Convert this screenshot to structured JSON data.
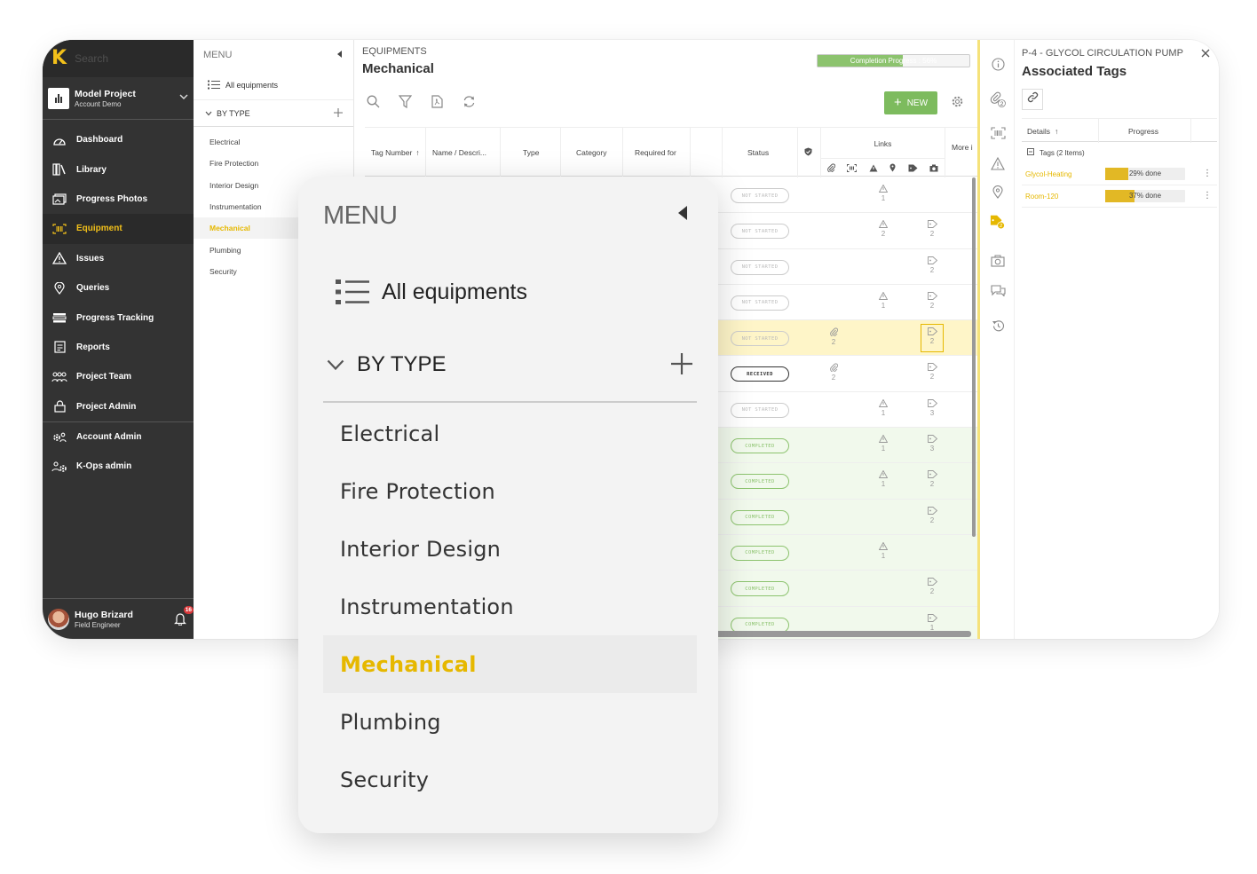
{
  "sidebar": {
    "search_placeholder": "Search",
    "project": {
      "name": "Model Project",
      "account": "Account Demo"
    },
    "items": [
      {
        "label": "Dashboard",
        "icon": "dashboard-icon"
      },
      {
        "label": "Library",
        "icon": "library-icon"
      },
      {
        "label": "Progress Photos",
        "icon": "photos-icon"
      },
      {
        "label": "Equipment",
        "icon": "barcode-icon",
        "active": true
      },
      {
        "label": "Issues",
        "icon": "warning-icon"
      },
      {
        "label": "Queries",
        "icon": "location-pin-icon"
      },
      {
        "label": "Progress Tracking",
        "icon": "tracking-icon"
      },
      {
        "label": "Reports",
        "icon": "report-icon"
      },
      {
        "label": "Project Team",
        "icon": "team-icon"
      },
      {
        "label": "Project Admin",
        "icon": "lock-icon"
      }
    ],
    "admin_items": [
      {
        "label": "Account Admin",
        "icon": "gear-users-icon"
      },
      {
        "label": "K-Ops admin",
        "icon": "gear-user-icon"
      }
    ],
    "user": {
      "name": "Hugo Brizard",
      "role": "Field Engineer",
      "notifications": "16"
    }
  },
  "menu": {
    "title": "MENU",
    "all_label": "All equipments",
    "by_type_label": "BY TYPE",
    "types": [
      "Electrical",
      "Fire Protection",
      "Interior Design",
      "Instrumentation",
      "Mechanical",
      "Plumbing",
      "Security"
    ],
    "active_type": "Mechanical"
  },
  "main": {
    "subtitle": "EQUIPMENTS",
    "title": "Mechanical",
    "progress_label": "Completion Progress : 56%",
    "progress_value": 56,
    "new_label": "NEW",
    "columns": [
      "Tag Number",
      "Name / Descri...",
      "Type",
      "Category",
      "Required for",
      "Status"
    ],
    "links_label": "Links",
    "more_label": "More i",
    "rows": [
      {
        "status": "NOT STARTED",
        "warn": "1",
        "clip": "",
        "tag": ""
      },
      {
        "status": "NOT STARTED",
        "warn": "2",
        "clip": "",
        "tag": "2"
      },
      {
        "status": "NOT STARTED",
        "warn": "",
        "clip": "",
        "tag": "2"
      },
      {
        "status": "NOT STARTED",
        "warn": "1",
        "clip": "",
        "tag": "2"
      },
      {
        "status": "NOT STARTED",
        "warn": "",
        "clip": "2",
        "tag": "2",
        "highlight": true
      },
      {
        "status": "RECEIVED",
        "warn": "",
        "clip": "2",
        "tag": "2"
      },
      {
        "status": "NOT STARTED",
        "warn": "1",
        "clip": "",
        "tag": "3"
      },
      {
        "status": "COMPLETED",
        "warn": "1",
        "clip": "",
        "tag": "3"
      },
      {
        "status": "COMPLETED",
        "warn": "1",
        "clip": "",
        "tag": "2"
      },
      {
        "status": "COMPLETED",
        "warn": "",
        "clip": "",
        "tag": "2"
      },
      {
        "status": "COMPLETED",
        "warn": "1",
        "clip": "",
        "tag": ""
      },
      {
        "status": "COMPLETED",
        "warn": "",
        "clip": "",
        "tag": "2"
      },
      {
        "status": "COMPLETED",
        "warn": "",
        "clip": "",
        "tag": "1"
      }
    ]
  },
  "strip": {
    "attachments_count": "2",
    "tags_count": "2"
  },
  "details": {
    "subtitle": "P-4 - GLYCOL CIRCULATION PUMP",
    "title": "Associated Tags",
    "col_details": "Details",
    "col_progress": "Progress",
    "group_label": "Tags (2 Items)",
    "tags": [
      {
        "name": "Glycol-Heating",
        "progress_label": "29% done",
        "progress": 29
      },
      {
        "name": "Room-120",
        "progress_label": "37% done",
        "progress": 37
      }
    ]
  },
  "colors": {
    "accent": "#e6b800",
    "sidebar_bg": "#333333",
    "success": "#8cc36e",
    "highlight_row": "#fef5c8"
  }
}
